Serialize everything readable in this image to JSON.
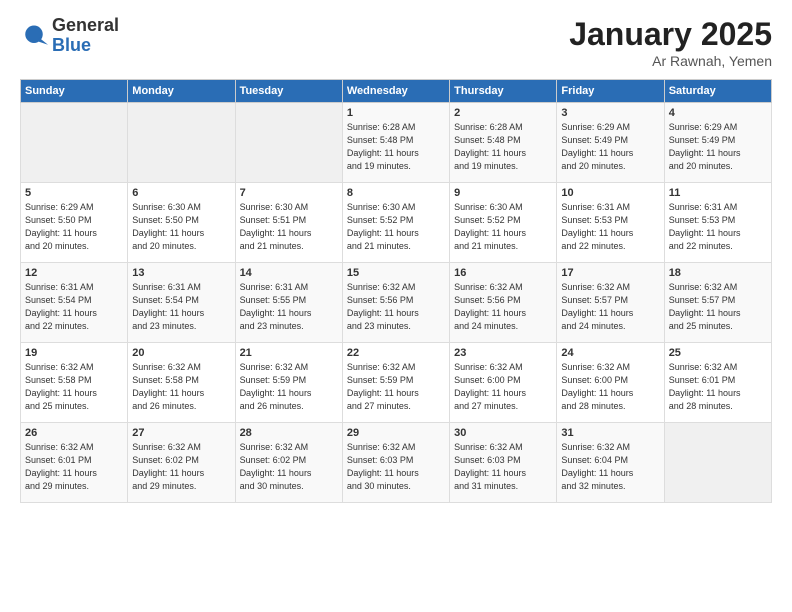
{
  "logo": {
    "general": "General",
    "blue": "Blue"
  },
  "title": "January 2025",
  "subtitle": "Ar Rawnah, Yemen",
  "days_of_week": [
    "Sunday",
    "Monday",
    "Tuesday",
    "Wednesday",
    "Thursday",
    "Friday",
    "Saturday"
  ],
  "weeks": [
    [
      {
        "day": "",
        "info": ""
      },
      {
        "day": "",
        "info": ""
      },
      {
        "day": "",
        "info": ""
      },
      {
        "day": "1",
        "info": "Sunrise: 6:28 AM\nSunset: 5:48 PM\nDaylight: 11 hours\nand 19 minutes."
      },
      {
        "day": "2",
        "info": "Sunrise: 6:28 AM\nSunset: 5:48 PM\nDaylight: 11 hours\nand 19 minutes."
      },
      {
        "day": "3",
        "info": "Sunrise: 6:29 AM\nSunset: 5:49 PM\nDaylight: 11 hours\nand 20 minutes."
      },
      {
        "day": "4",
        "info": "Sunrise: 6:29 AM\nSunset: 5:49 PM\nDaylight: 11 hours\nand 20 minutes."
      }
    ],
    [
      {
        "day": "5",
        "info": "Sunrise: 6:29 AM\nSunset: 5:50 PM\nDaylight: 11 hours\nand 20 minutes."
      },
      {
        "day": "6",
        "info": "Sunrise: 6:30 AM\nSunset: 5:50 PM\nDaylight: 11 hours\nand 20 minutes."
      },
      {
        "day": "7",
        "info": "Sunrise: 6:30 AM\nSunset: 5:51 PM\nDaylight: 11 hours\nand 21 minutes."
      },
      {
        "day": "8",
        "info": "Sunrise: 6:30 AM\nSunset: 5:52 PM\nDaylight: 11 hours\nand 21 minutes."
      },
      {
        "day": "9",
        "info": "Sunrise: 6:30 AM\nSunset: 5:52 PM\nDaylight: 11 hours\nand 21 minutes."
      },
      {
        "day": "10",
        "info": "Sunrise: 6:31 AM\nSunset: 5:53 PM\nDaylight: 11 hours\nand 22 minutes."
      },
      {
        "day": "11",
        "info": "Sunrise: 6:31 AM\nSunset: 5:53 PM\nDaylight: 11 hours\nand 22 minutes."
      }
    ],
    [
      {
        "day": "12",
        "info": "Sunrise: 6:31 AM\nSunset: 5:54 PM\nDaylight: 11 hours\nand 22 minutes."
      },
      {
        "day": "13",
        "info": "Sunrise: 6:31 AM\nSunset: 5:54 PM\nDaylight: 11 hours\nand 23 minutes."
      },
      {
        "day": "14",
        "info": "Sunrise: 6:31 AM\nSunset: 5:55 PM\nDaylight: 11 hours\nand 23 minutes."
      },
      {
        "day": "15",
        "info": "Sunrise: 6:32 AM\nSunset: 5:56 PM\nDaylight: 11 hours\nand 23 minutes."
      },
      {
        "day": "16",
        "info": "Sunrise: 6:32 AM\nSunset: 5:56 PM\nDaylight: 11 hours\nand 24 minutes."
      },
      {
        "day": "17",
        "info": "Sunrise: 6:32 AM\nSunset: 5:57 PM\nDaylight: 11 hours\nand 24 minutes."
      },
      {
        "day": "18",
        "info": "Sunrise: 6:32 AM\nSunset: 5:57 PM\nDaylight: 11 hours\nand 25 minutes."
      }
    ],
    [
      {
        "day": "19",
        "info": "Sunrise: 6:32 AM\nSunset: 5:58 PM\nDaylight: 11 hours\nand 25 minutes."
      },
      {
        "day": "20",
        "info": "Sunrise: 6:32 AM\nSunset: 5:58 PM\nDaylight: 11 hours\nand 26 minutes."
      },
      {
        "day": "21",
        "info": "Sunrise: 6:32 AM\nSunset: 5:59 PM\nDaylight: 11 hours\nand 26 minutes."
      },
      {
        "day": "22",
        "info": "Sunrise: 6:32 AM\nSunset: 5:59 PM\nDaylight: 11 hours\nand 27 minutes."
      },
      {
        "day": "23",
        "info": "Sunrise: 6:32 AM\nSunset: 6:00 PM\nDaylight: 11 hours\nand 27 minutes."
      },
      {
        "day": "24",
        "info": "Sunrise: 6:32 AM\nSunset: 6:00 PM\nDaylight: 11 hours\nand 28 minutes."
      },
      {
        "day": "25",
        "info": "Sunrise: 6:32 AM\nSunset: 6:01 PM\nDaylight: 11 hours\nand 28 minutes."
      }
    ],
    [
      {
        "day": "26",
        "info": "Sunrise: 6:32 AM\nSunset: 6:01 PM\nDaylight: 11 hours\nand 29 minutes."
      },
      {
        "day": "27",
        "info": "Sunrise: 6:32 AM\nSunset: 6:02 PM\nDaylight: 11 hours\nand 29 minutes."
      },
      {
        "day": "28",
        "info": "Sunrise: 6:32 AM\nSunset: 6:02 PM\nDaylight: 11 hours\nand 30 minutes."
      },
      {
        "day": "29",
        "info": "Sunrise: 6:32 AM\nSunset: 6:03 PM\nDaylight: 11 hours\nand 30 minutes."
      },
      {
        "day": "30",
        "info": "Sunrise: 6:32 AM\nSunset: 6:03 PM\nDaylight: 11 hours\nand 31 minutes."
      },
      {
        "day": "31",
        "info": "Sunrise: 6:32 AM\nSunset: 6:04 PM\nDaylight: 11 hours\nand 32 minutes."
      },
      {
        "day": "",
        "info": ""
      }
    ]
  ]
}
